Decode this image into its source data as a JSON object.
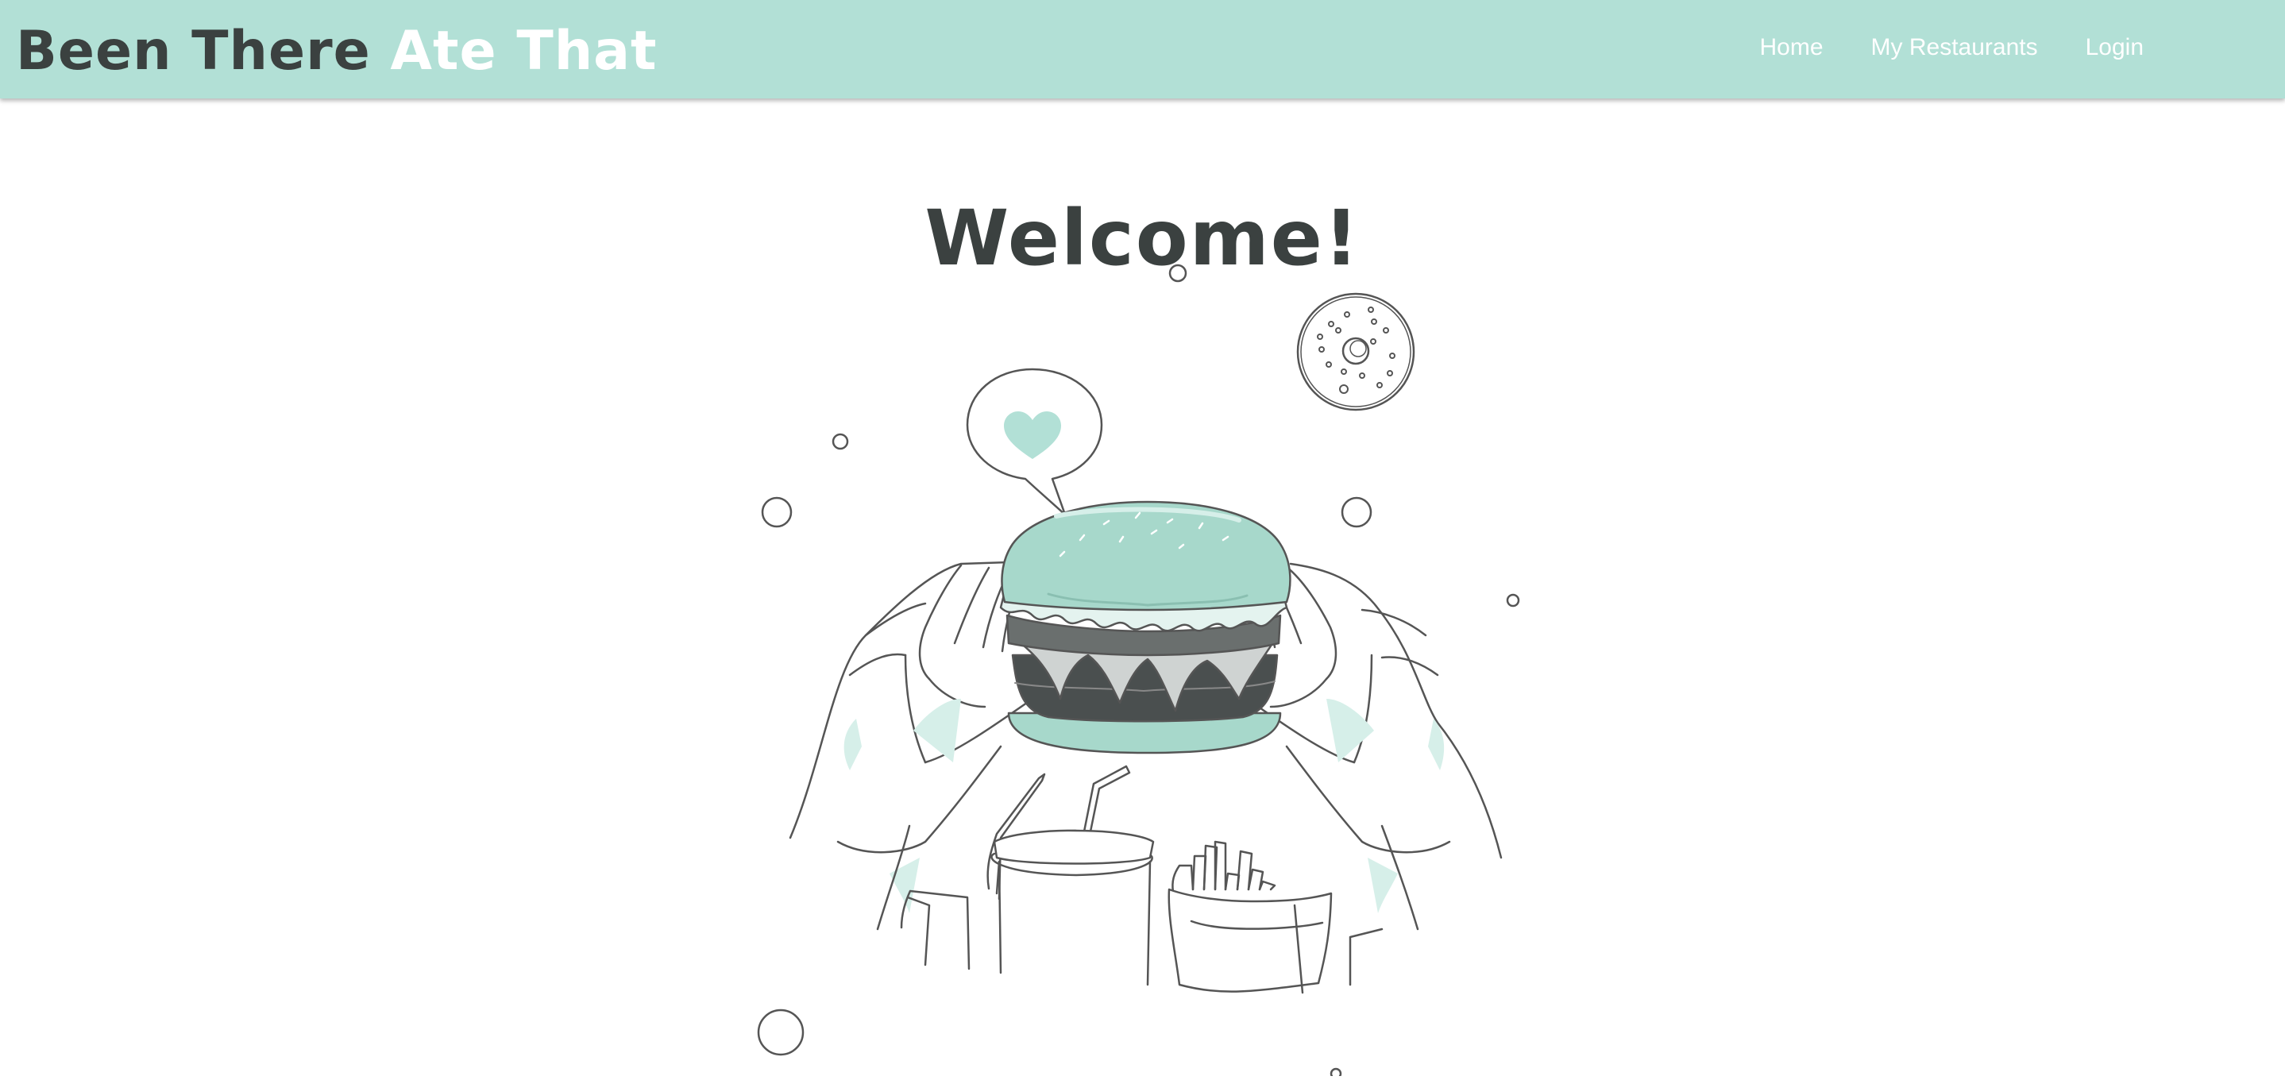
{
  "navbar": {
    "brand_part1": "Been There",
    "brand_part2": "Ate That",
    "links": [
      {
        "label": "Home"
      },
      {
        "label": "My Restaurants"
      },
      {
        "label": "Login"
      }
    ]
  },
  "main": {
    "heading": "Welcome!",
    "illustration": {
      "icon": "burger-hands-illustration",
      "accent_color": "#b2e0d6",
      "line_color": "#555555"
    }
  },
  "colors": {
    "navbar_bg": "#b2e0d6",
    "brand_dark": "#3b4140",
    "brand_light": "#ffffff",
    "heading": "#3b4140"
  }
}
